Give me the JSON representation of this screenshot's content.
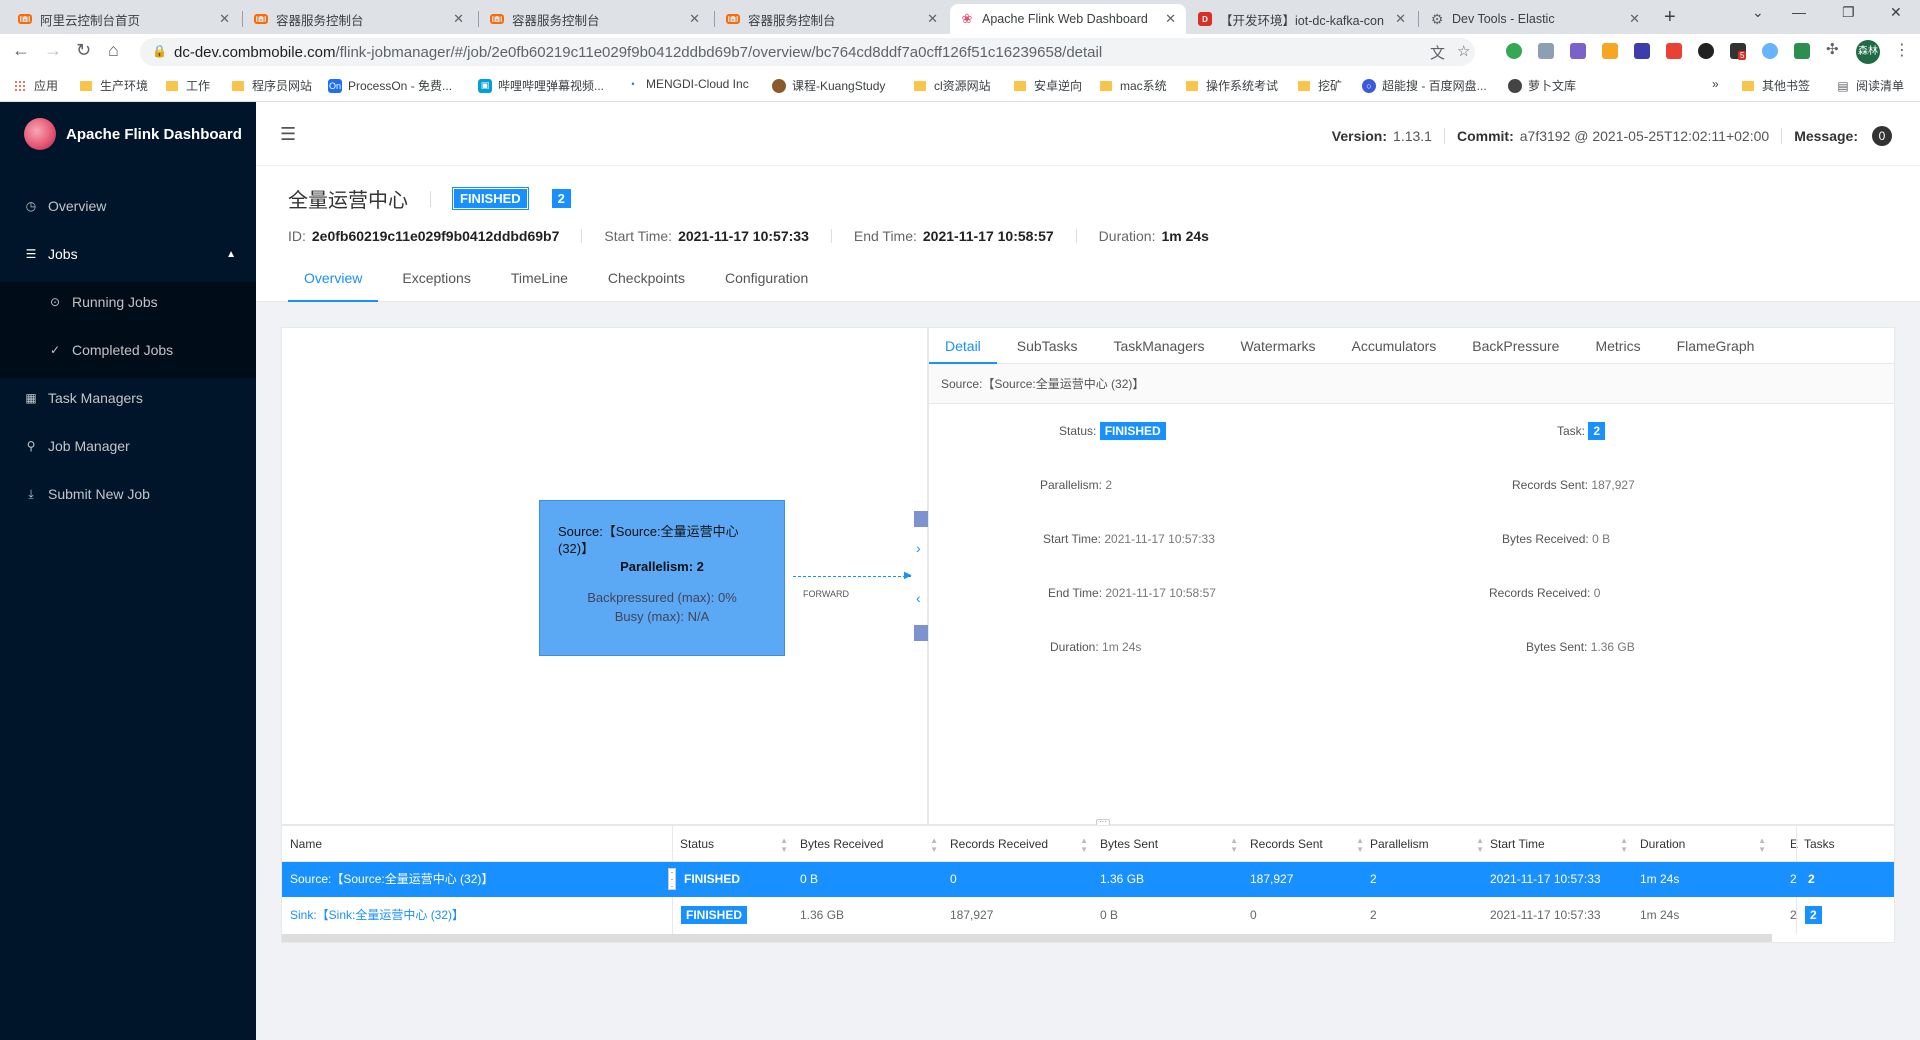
{
  "browser": {
    "tabs": [
      {
        "title": "阿里云控制台首页",
        "icon": "aliyun-icon"
      },
      {
        "title": "容器服务控制台",
        "icon": "aliyun-icon"
      },
      {
        "title": "容器服务控制台",
        "icon": "aliyun-icon"
      },
      {
        "title": "容器服务控制台",
        "icon": "aliyun-icon"
      },
      {
        "title": "Apache Flink Web Dashboard",
        "icon": "flink-icon",
        "active": true
      },
      {
        "title": "【开发环境】iot-dc-kafka-con",
        "icon": "kafka-icon"
      },
      {
        "title": "Dev Tools - Elastic",
        "icon": "elastic-icon"
      }
    ],
    "url_host": "dc-dev.combmobile.com",
    "url_path": "/flink-jobmanager/#/job/2e0fb60219c11e029f9b0412ddbd69b7/overview/bc764cd8ddf7a0cff126f51c16239658/detail",
    "extension_badge": "5",
    "profile_label": "森林",
    "bookmarks": [
      "应用",
      "生产环境",
      "工作",
      "程序员网站",
      "ProcessOn - 免费...",
      "哔哩哔哩弹幕视频...",
      "MENGDI-Cloud Inc",
      "课程-KuangStudy",
      "cl资源网站",
      "安卓逆向",
      "mac系统",
      "操作系统考试",
      "挖矿",
      "超能搜 - 百度网盘...",
      "萝卜文库"
    ],
    "bookmarks_right": [
      "其他书签",
      "阅读清单"
    ],
    "bookmarks_more": "»"
  },
  "app": {
    "brand": "Apache Flink Dashboard",
    "menu": {
      "overview": "Overview",
      "jobs": "Jobs",
      "running_jobs": "Running Jobs",
      "completed_jobs": "Completed Jobs",
      "task_managers": "Task Managers",
      "job_manager": "Job Manager",
      "submit_new_job": "Submit New Job"
    },
    "header": {
      "version_label": "Version:",
      "version": "1.13.1",
      "commit_label": "Commit:",
      "commit": "a7f3192 @ 2021-05-25T12:02:11+02:00",
      "message_label": "Message:",
      "message_count": "0"
    }
  },
  "job": {
    "name": "全量运营中心",
    "status": "FINISHED",
    "task_count": "2",
    "id_label": "ID:",
    "id": "2e0fb60219c11e029f9b0412ddbd69b7",
    "start_label": "Start Time:",
    "start": "2021-11-17 10:57:33",
    "end_label": "End Time:",
    "end": "2021-11-17 10:58:57",
    "duration_label": "Duration:",
    "duration": "1m 24s",
    "tabs": [
      "Overview",
      "Exceptions",
      "TimeLine",
      "Checkpoints",
      "Configuration"
    ]
  },
  "graph": {
    "node_name": "Source:【Source:全量运营中心 (32)】",
    "node_parallelism": "Parallelism: 2",
    "node_backpressure": "Backpressured (max): 0%",
    "node_busy": "Busy (max): N/A",
    "edge_label": "FORWARD"
  },
  "detail": {
    "tabs": [
      "Detail",
      "SubTasks",
      "TaskManagers",
      "Watermarks",
      "Accumulators",
      "BackPressure",
      "Metrics",
      "FlameGraph"
    ],
    "vertex": "Source:【Source:全量运营中心 (32)】",
    "status_label": "Status:",
    "status": "FINISHED",
    "task_label": "Task:",
    "task": "2",
    "parallelism_label": "Parallelism:",
    "parallelism": "2",
    "records_sent_label": "Records Sent:",
    "records_sent": "187,927",
    "start_label": "Start Time:",
    "start": "2021-11-17 10:57:33",
    "bytes_received_label": "Bytes Received:",
    "bytes_received": "0 B",
    "end_label": "End Time:",
    "end": "2021-11-17 10:58:57",
    "records_received_label": "Records Received:",
    "records_received": "0",
    "duration_label": "Duration:",
    "duration": "1m 24s",
    "bytes_sent_label": "Bytes Sent:",
    "bytes_sent": "1.36 GB"
  },
  "table": {
    "columns": [
      "Name",
      "Status",
      "Bytes Received",
      "Records Received",
      "Bytes Sent",
      "Records Sent",
      "Parallelism",
      "Start Time",
      "Duration",
      "E",
      "Tasks"
    ],
    "rows": [
      {
        "name": "Source:【Source:全量运营中心 (32)】",
        "status": "FINISHED",
        "bytes_received": "0 B",
        "records_received": "0",
        "bytes_sent": "1.36 GB",
        "records_sent": "187,927",
        "parallelism": "2",
        "start": "2021-11-17 10:57:33",
        "duration": "1m 24s",
        "end_trunc": "2",
        "tasks": "2"
      },
      {
        "name": "Sink:【Sink:全量运营中心 (32)】",
        "status": "FINISHED",
        "bytes_received": "1.36 GB",
        "records_received": "187,927",
        "bytes_sent": "0 B",
        "records_sent": "0",
        "parallelism": "2",
        "start": "2021-11-17 10:57:33",
        "duration": "1m 24s",
        "end_trunc": "2",
        "tasks": "2"
      }
    ]
  },
  "colors": {
    "accent": "#1890ff",
    "sidebar": "#001529",
    "node": "#5ba9f5"
  }
}
